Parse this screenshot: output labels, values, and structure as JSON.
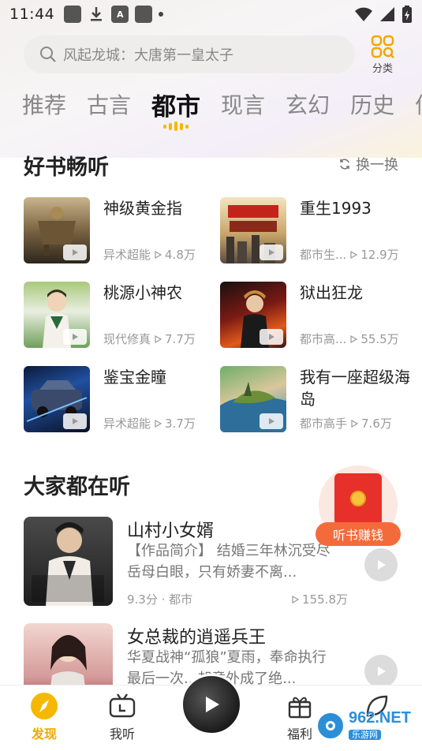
{
  "status_bar": {
    "time": "11:44",
    "icons": [
      "gallery-icon",
      "download-icon",
      "a-icon",
      "gallery-icon",
      "dot-icon"
    ],
    "right_icons": [
      "wifi-icon",
      "signal-icon",
      "battery-icon"
    ]
  },
  "search": {
    "placeholder": "风起龙城：大唐第一皇太子",
    "category_label": "分类"
  },
  "tabs": [
    {
      "label": "推荐",
      "active": false
    },
    {
      "label": "古言",
      "active": false
    },
    {
      "label": "都市",
      "active": true
    },
    {
      "label": "现言",
      "active": false
    },
    {
      "label": "玄幻",
      "active": false
    },
    {
      "label": "历史",
      "active": false
    },
    {
      "label": "仙",
      "active": false
    }
  ],
  "good_books": {
    "title": "好书畅听",
    "refresh_label": "换一换",
    "items": [
      {
        "title": "神级黄金指",
        "genre": "异术超能",
        "plays": "4.8万"
      },
      {
        "title": "重生1993",
        "genre": "都市生...",
        "plays": "12.9万"
      },
      {
        "title": "桃源小神农",
        "genre": "现代修真",
        "plays": "7.7万"
      },
      {
        "title": "狱出狂龙",
        "genre": "都市高...",
        "plays": "55.5万"
      },
      {
        "title": "鉴宝金瞳",
        "genre": "异术超能",
        "plays": "3.7万"
      },
      {
        "title": "我有一座超级海岛",
        "genre": "都市高手",
        "plays": "7.6万"
      }
    ]
  },
  "everyone_listening": {
    "title": "大家都在听",
    "items": [
      {
        "title": "山村小女婿",
        "desc": "【作品简介】 结婚三年林沉受尽岳母白眼，只有娇妻不离...",
        "score": "9.3分 · 都市",
        "plays": "155.8万"
      },
      {
        "title": "女总裁的逍遥兵王",
        "desc": "华夏战神“孤狼”夏雨，奉命执行最后一次...却意外成了绝...",
        "score": "",
        "plays": ""
      }
    ]
  },
  "earn": {
    "label": "听书赚钱"
  },
  "bottom_nav": {
    "items": [
      {
        "label": "发现",
        "active": true
      },
      {
        "label": "我听",
        "active": false
      },
      {
        "label": "福利",
        "active": false
      },
      {
        "label": "",
        "active": false
      }
    ]
  },
  "watermark": {
    "logo": "962",
    "domain": ".NET",
    "sub": "乐游网"
  },
  "colors": {
    "accent": "#f5b800",
    "earn": "#f36b3a",
    "envelope": "#e8302a"
  }
}
